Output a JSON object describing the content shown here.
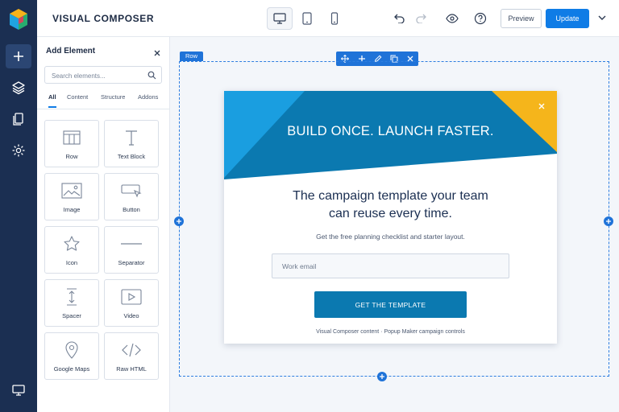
{
  "app": {
    "brand": "VISUAL COMPOSER"
  },
  "rail": {
    "items": [
      {
        "icon": "plus-icon"
      },
      {
        "icon": "layers-icon"
      },
      {
        "icon": "pages-icon"
      },
      {
        "icon": "settings-icon"
      },
      {
        "icon": "desktop-icon"
      }
    ]
  },
  "toolbar": {
    "devices": [
      "desktop-icon",
      "tablet-icon",
      "mobile-icon"
    ],
    "active_device": "desktop",
    "preview_label": "Preview",
    "update_label": "Update"
  },
  "panel": {
    "title": "Add Element",
    "search_placeholder": "Search elements...",
    "tabs": [
      "All",
      "Content",
      "Structure",
      "Addons"
    ],
    "active_tab": "All",
    "elements": [
      {
        "label": "Row",
        "icon": "row-icon"
      },
      {
        "label": "Text Block",
        "icon": "text-block-icon"
      },
      {
        "label": "Image",
        "icon": "image-icon"
      },
      {
        "label": "Button",
        "icon": "button-icon"
      },
      {
        "label": "Icon",
        "icon": "star-icon"
      },
      {
        "label": "Separator",
        "icon": "separator-icon"
      },
      {
        "label": "Spacer",
        "icon": "spacer-icon"
      },
      {
        "label": "Video",
        "icon": "video-icon"
      },
      {
        "label": "Google Maps",
        "icon": "map-pin-icon"
      },
      {
        "label": "Raw HTML",
        "icon": "code-icon"
      }
    ]
  },
  "canvas": {
    "row_tag": "Row",
    "popup": {
      "headline": "BUILD ONCE. LAUNCH FASTER.",
      "subheadline_line1": "The campaign template your team",
      "subheadline_line2": "can reuse every time.",
      "description": "Get the free planning checklist and starter layout.",
      "email_placeholder": "Work email",
      "cta_label": "GET THE TEMPLATE",
      "footnote": "Visual Composer content  ·  Popup Maker campaign controls"
    }
  },
  "colors": {
    "rail_bg": "#1b2f52",
    "accent": "#0f7ce6",
    "banner_blue": "#0b79b0",
    "banner_light": "#1a9ee0",
    "banner_yellow": "#f5b51b"
  }
}
